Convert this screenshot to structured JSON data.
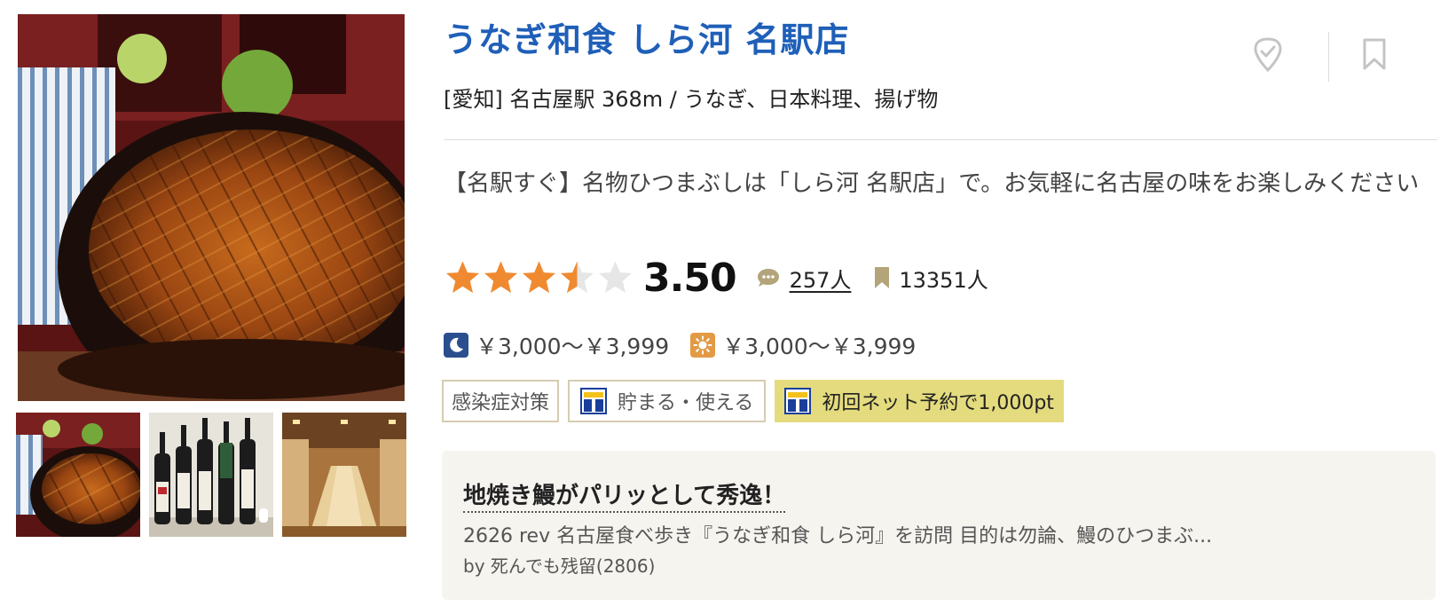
{
  "restaurant": {
    "name": "うなぎ和食 しら河 名駅店",
    "area_line": "[愛知] 名古屋駅 368m / うなぎ、日本料理、揚げ物",
    "catch_copy": "【名駅すぐ】名物ひつまぶしは「しら河 名駅店」で。お気軽に名古屋の味をお楽しみください"
  },
  "rating": {
    "score": "3.50",
    "stars_value": 3.5,
    "stars_max": 5,
    "review_count": "257人",
    "save_count": "13351人"
  },
  "prices": {
    "dinner": "￥3,000～￥3,999",
    "lunch": "￥3,000～￥3,999"
  },
  "tags": {
    "infection": "感染症対策",
    "tpoint": "貯まる・使える",
    "promo": "初回ネット予約で1,000pt"
  },
  "review": {
    "title": "地焼き鰻がパリッとして秀逸！",
    "snippet": "2626 rev 名古屋食べ歩き『うなぎ和食 しら河』を訪問 目的は勿論、鰻のひつまぶ...",
    "author": "by 死んでも残留(2806)"
  },
  "icons": {
    "visited": "check-heart-icon",
    "save": "bookmark-icon",
    "review": "speech-bubble-icon",
    "saved": "bookmark-icon",
    "dinner": "moon-icon",
    "lunch": "sun-icon",
    "tpoint": "t-point-icon"
  },
  "colors": {
    "title": "#1f5fb8",
    "star": "#f08a30",
    "star_empty": "#e6e6e6",
    "promo_bg": "#e4db7e",
    "review_bg": "#f6f4ef",
    "icon_tan": "#b3a47a"
  }
}
